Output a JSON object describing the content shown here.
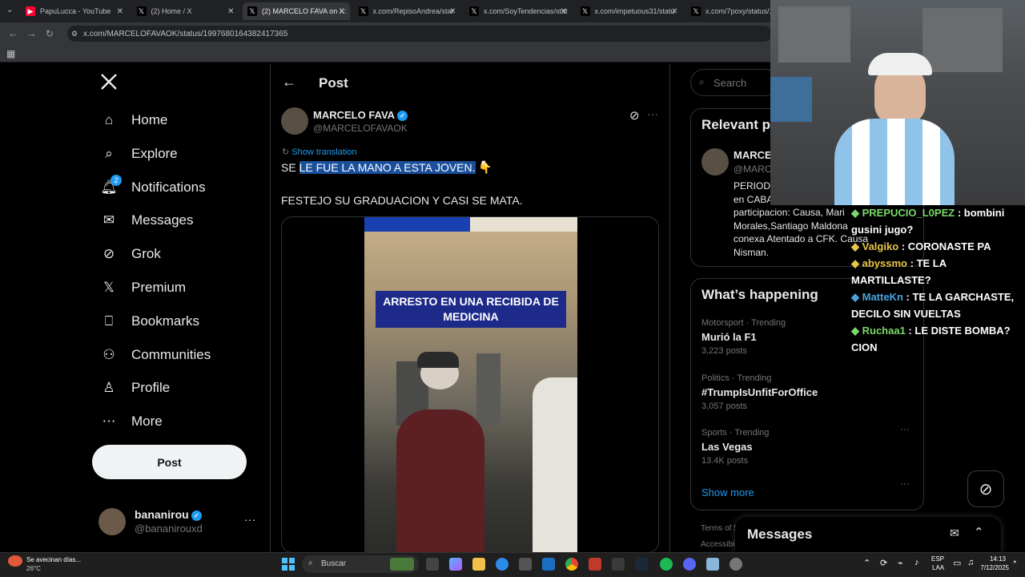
{
  "browser": {
    "tabs": [
      {
        "title": "PapuLucca - YouTube",
        "icon": "youtube-icon",
        "color": "#ff0033"
      },
      {
        "title": "(2) Home / X",
        "icon": "x-logo-icon",
        "color": "#000000"
      },
      {
        "title": "(2) MARCELO FAVA on X:",
        "icon": "x-logo-icon",
        "color": "#000000"
      },
      {
        "title": "x.com/RepisoAndrea/stat",
        "icon": "x-logo-icon",
        "color": "#000000"
      },
      {
        "title": "x.com/SoyTendencias/stat",
        "icon": "x-logo-icon",
        "color": "#000000"
      },
      {
        "title": "x.com/impetuous31/statu",
        "icon": "x-logo-icon",
        "color": "#000000"
      },
      {
        "title": "x.com/7poxy/status/19",
        "icon": "x-logo-icon",
        "color": "#000000"
      }
    ],
    "url": "x.com/MARCELOFAVAOK/status/1997680164382417365"
  },
  "nav": {
    "items": [
      {
        "label": "Home",
        "icon": "home-icon"
      },
      {
        "label": "Explore",
        "icon": "search-icon"
      },
      {
        "label": "Notifications",
        "icon": "bell-icon",
        "badge": "2"
      },
      {
        "label": "Messages",
        "icon": "mail-icon"
      },
      {
        "label": "Grok",
        "icon": "grok-icon"
      },
      {
        "label": "Premium",
        "icon": "x-logo-icon"
      },
      {
        "label": "Bookmarks",
        "icon": "bookmark-icon"
      },
      {
        "label": "Communities",
        "icon": "people-icon"
      },
      {
        "label": "Profile",
        "icon": "person-icon"
      },
      {
        "label": "More",
        "icon": "more-circle-icon"
      }
    ],
    "post_label": "Post",
    "account": {
      "name": "bananirou",
      "handle": "@bananirouxd"
    }
  },
  "post": {
    "header_title": "Post",
    "author_name": "MARCELO FAVA",
    "author_handle": "@MARCELOFAVAOK",
    "show_translation": "Show translation",
    "text_prefix": "SE",
    "text_selected": "LE FUE LA MANO A ESTA JOVEN.",
    "text_line2": "FESTEJO SU GRADUACION Y CASI SE MATA.",
    "video_caption": "ARRESTO EN UNA RECIBIDA DE MEDICINA"
  },
  "right": {
    "search_placeholder": "Search",
    "relevant_title": "Relevant p",
    "relevant_name": "MARCE",
    "relevant_handle": "@MARC",
    "relevant_bio": [
      "PERIOD",
      "en CABA",
      "participacion: Causa, Mari",
      "Morales,Santiago Maldona",
      "conexa Atentado a CFK. Causa",
      "Nisman."
    ],
    "happening_title": "What’s happening",
    "trends": [
      {
        "meta": "Motorsport · Trending",
        "title": "Murió la F1",
        "posts": "3,223 posts"
      },
      {
        "meta": "Politics · Trending",
        "title": "#TrumpIsUnfitForOffice",
        "posts": "3,057 posts"
      },
      {
        "meta": "Sports · Trending",
        "title": "Las Vegas",
        "posts": "13.4K posts"
      }
    ],
    "show_more": "Show more",
    "footer": [
      "Terms of S",
      "Accessibili"
    ],
    "messages_title": "Messages"
  },
  "chat": [
    {
      "user": "PREPUCIO_L0PEZ",
      "sep": " :",
      "msg": "bombini gusini jugo?",
      "color": "#7ad96a"
    },
    {
      "user": "Valgiko",
      "sep": " :",
      "msg": "CORONASTE PA",
      "color": "#e7c64a"
    },
    {
      "user": "abyssmo",
      "sep": " :",
      "msg": "TE LA MARTILLASTE?",
      "color": "#e7c64a"
    },
    {
      "user": "MatteKn",
      "sep": " :",
      "msg": "TE LA GARCHASTE, DECILO SIN VUELTAS",
      "color": "#4aa3df"
    },
    {
      "user": "Ruchaa1",
      "sep": " :",
      "msg": "LE DISTE BOMBA?",
      "color": "#7ad96a"
    },
    {
      "user": "",
      "sep": "",
      "msg": "CION",
      "color": "#ffffff"
    }
  ],
  "taskbar": {
    "weather_text": "Se avecinan días...",
    "temp": "26°C",
    "search_label": "Buscar",
    "lang": "ESP",
    "lang2": "LAA",
    "time": "14:13",
    "date": "7/12/2025"
  }
}
